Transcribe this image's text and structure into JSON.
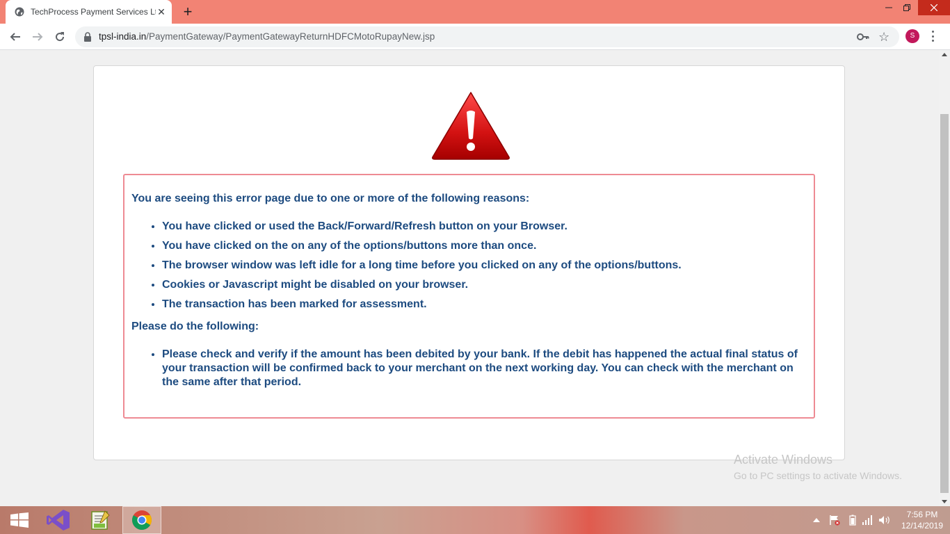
{
  "browser": {
    "tab_title": "TechProcess Payment Services Lt",
    "url_host": "tpsl-india.in",
    "url_path": "/PaymentGateway/PaymentGatewayReturnHDFCMotoRupayNew.jsp",
    "avatar_letter": "S",
    "theme_color": "#f28374"
  },
  "page": {
    "heading": "You are seeing this error page due to one or more of the following reasons:",
    "reasons": [
      "You have clicked or used the Back/Forward/Refresh button on your Browser.",
      "You have clicked on the on any of the options/buttons more than once.",
      "The browser window was left idle for a long time before you clicked on any of the options/buttons.",
      "Cookies or Javascript might be disabled on your browser.",
      "The transaction has been marked for assessment."
    ],
    "followup_heading": "Please do the following:",
    "actions": [
      "Please check and verify if the amount has been debited by your bank. If the debit has happened the actual final status of your transaction will be confirmed back to your merchant on the next working day. You can check with the merchant on the same after that period."
    ],
    "text_color": "#1d4b80",
    "border_color": "#ee8a93"
  },
  "watermark": {
    "title": "Activate Windows",
    "subtitle": "Go to PC settings to activate Windows."
  },
  "taskbar": {
    "time": "7:56 PM",
    "date": "12/14/2019",
    "apps": [
      "windows-start",
      "visual-studio",
      "notepad-plus-plus",
      "chrome"
    ]
  }
}
